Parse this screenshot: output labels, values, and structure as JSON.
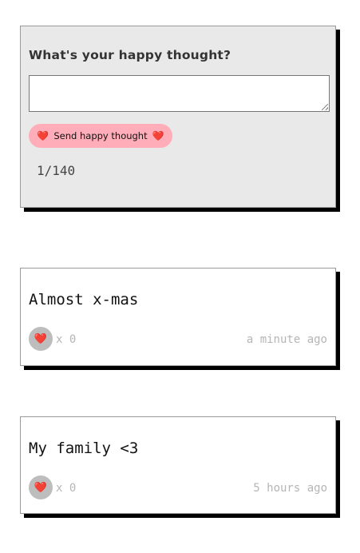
{
  "form": {
    "title": "What's your happy thought?",
    "input_value": "",
    "button_label": "Send happy thought",
    "button_icon": "❤️",
    "counter": "1/140"
  },
  "thoughts": [
    {
      "message": "Almost x-mas",
      "like_icon": "❤️",
      "likes": "x 0",
      "time": "a minute ago"
    },
    {
      "message": "My family <3",
      "like_icon": "❤️",
      "likes": "x 0",
      "time": "5 hours ago"
    }
  ],
  "colors": {
    "form_background": "#e9e9e9",
    "button_background": "#ffadb9",
    "like_button_background": "#bdbdbd",
    "heart": "#e0202a",
    "shadow": "#000000"
  }
}
